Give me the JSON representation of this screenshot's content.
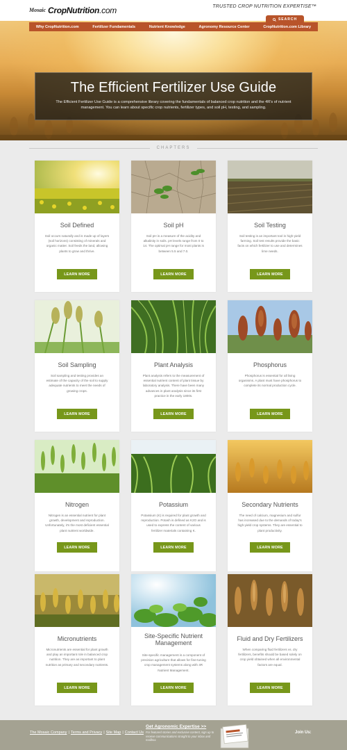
{
  "header": {
    "logo_mosaic": "Mosaic",
    "logo_brand_bold": "CropNutrition",
    "logo_brand_suffix": ".com",
    "tagline": "TRUSTED CROP NUTRITION EXPERTISE™",
    "search_label": "SEARCH"
  },
  "nav": {
    "items": [
      {
        "label": "Why CropNutrition.com"
      },
      {
        "label": "Fertilizer Fundamentals"
      },
      {
        "label": "Nutrient Knowledge"
      },
      {
        "label": "Agronomy Resource Center"
      },
      {
        "label": "CropNutrition.com Library"
      }
    ]
  },
  "hero": {
    "title": "The Efficient Fertilizer Use Guide",
    "description": "The Efficient Fertilizer Use Guide is a comprehensive library covering the fundamentals of balanced crop nutrition and the 4R's of nutrient management. You can learn about specific crop nutrients, fertilizer types, and soil pH, testing, and sampling."
  },
  "chapters": {
    "heading": "CHAPTERS",
    "button_label": "LEARN MORE",
    "items": [
      {
        "title": "Soil Defined",
        "description": "Soil occurs naturally and is made up of layers (soil horizons) consisting of minerals and organic matter. Soil feeds the land, allowing plants to grow and thrive.",
        "image": "canola-field"
      },
      {
        "title": "Soil pH",
        "description": "Soil pH is a measure of the acidity and alkalinity in soils. pH levels range from 0 to 14. The optimal pH range for most plants is between 5.5 and 7.0.",
        "image": "seedlings-in-dry-soil"
      },
      {
        "title": "Soil Testing",
        "description": "Soil testing is an important tool in high-yield farming. Soil test results provide the basic facts on which fertilizer to use and determines lime needs.",
        "image": "plowed-field"
      },
      {
        "title": "Soil Sampling",
        "description": "Soil sampling and testing provides an estimate of the capacity of the soil to supply adequate nutrients to meet the needs of growing crops.",
        "image": "sorghum-heads"
      },
      {
        "title": "Plant Analysis",
        "description": "Plant analysis refers to the measurement of essential nutrient content of plant tissue by laboratory analysis. There have been many advances in plant analysis since its first practice in the early 1800s.",
        "image": "corn-rows"
      },
      {
        "title": "Phosphorus",
        "description": "Phosphorus is essential for all living organisms. A plant must have phosphorus to complete its normal production cycle.",
        "image": "red-sorghum"
      },
      {
        "title": "Nitrogen",
        "description": "Nitrogen is an essential nutrient for plant growth, development and reproduction. Unfortunately, it's the most deficient essential plant nutrient worldwide.",
        "image": "green-wheat"
      },
      {
        "title": "Potassium",
        "description": "Potassium (K) is required for plant growth and reproduction. Potash is defined as K2O and is used to express the content of various fertilizer materials containing K.",
        "image": "corn-field"
      },
      {
        "title": "Secondary Nutrients",
        "description": "The need of calcium, magnesium and sulfur has increased due to the demands of today's high-yield crop systems. They are essential to plant productivity.",
        "image": "golden-wheat"
      },
      {
        "title": "Micronutrients",
        "description": "Micronutrients are essential for plant growth and play an important role in balanced crop nutrition. They are as important to plant nutrition as primary and secondary nutrients.",
        "image": "ripening-wheat"
      },
      {
        "title": "Site-Specific Nutrient Management",
        "description": "Site-specific management is a component of precision agriculture that allows for fine-tuning crop management systems along with 4R Nutrient Management.",
        "image": "soybean-leaves"
      },
      {
        "title": "Fluid and Dry Fertilizers",
        "description": "When comparing fluid fertilizers vs. dry fertilizers, benefits should be based solely on crop yield obtained when all environmental factors are equal.",
        "image": "wheat-close-up"
      }
    ]
  },
  "footer": {
    "links": [
      "The Mosaic Company",
      "Terms and Privacy",
      "Site Map",
      "Contact Us"
    ],
    "cta_title": "Get Agronomic Expertise >>",
    "cta_description": "For featured stories and exclusive content, sign up to receive communications straight to your inbox and mailbox.",
    "join_label": "Join Us:"
  },
  "colors": {
    "accent": "#b8542a",
    "button": "#77971a",
    "footer": "#a4a292"
  }
}
